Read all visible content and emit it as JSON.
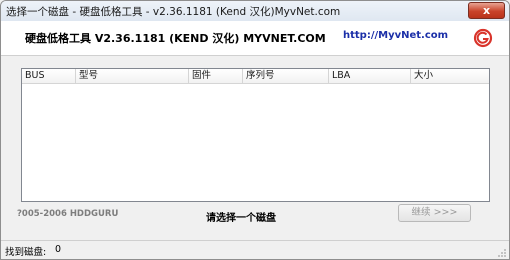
{
  "window": {
    "title": "选择一个磁盘 - 硬盘低格工具 - v2.36.1181 (Kend 汉化)MyvNet.com",
    "close_label": "x"
  },
  "header": {
    "app_name": "硬盘低格工具 V2.36.1181 (KEND 汉化) MYVNET.COM",
    "url": "http://MyvNet.com",
    "logo_icon": "hddguru-logo-icon",
    "logo_color": "#d9342b"
  },
  "table": {
    "columns": [
      "BUS",
      "型号",
      "固件",
      "序列号",
      "LBA",
      "大小"
    ],
    "rows": []
  },
  "footer": {
    "copyright": "?005-2006 HDDGURU",
    "prompt": "请选择一个磁盘",
    "continue_label": "继续 >>>"
  },
  "status": {
    "label": "找到磁盘:",
    "value": "0"
  }
}
